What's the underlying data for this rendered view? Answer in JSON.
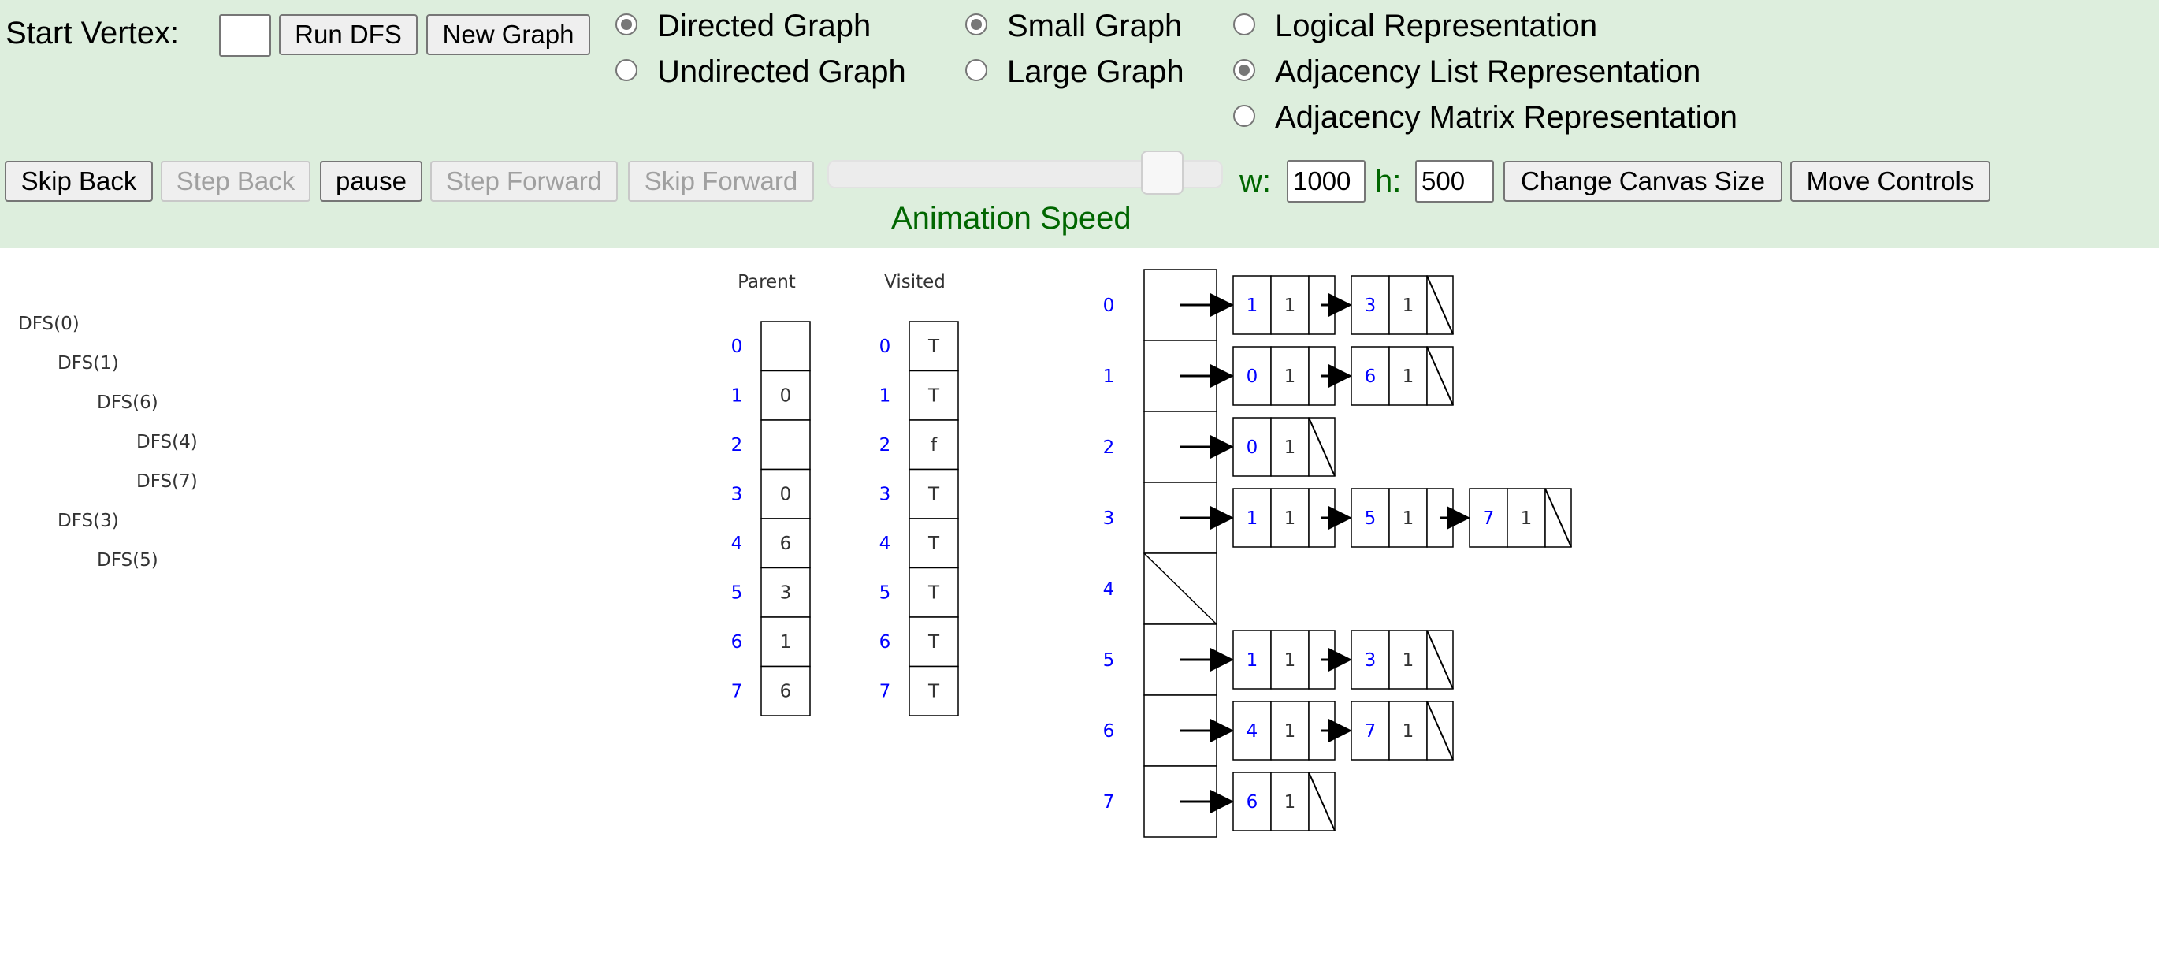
{
  "controls": {
    "start_vertex_label": "Start Vertex:",
    "start_vertex_value": "",
    "run_button": "Run DFS",
    "new_graph_button": "New Graph",
    "graph_type": {
      "directed": "Directed Graph",
      "undirected": "Undirected Graph",
      "selected": "directed"
    },
    "graph_size": {
      "small": "Small Graph",
      "large": "Large Graph",
      "selected": "small"
    },
    "representation": {
      "logical": "Logical Representation",
      "adjlist": "Adjacency List Representation",
      "adjmatrix": "Adjacency Matrix Representation",
      "selected": "adjlist"
    },
    "skip_back": "Skip Back",
    "step_back": "Step Back",
    "pause": "pause",
    "step_forward": "Step Forward",
    "skip_forward": "Skip Forward",
    "animation_speed": "Animation Speed",
    "width_label": "w:",
    "width_value": "1000",
    "height_label": "h:",
    "height_value": "500",
    "change_canvas_button": "Change Canvas Size",
    "move_controls_button": "Move Controls"
  },
  "colors": {
    "bar_bg": "#ddeedd",
    "green_text": "#006600",
    "index_blue": "#0000ff"
  },
  "animation": {
    "dfs_calls": [
      {
        "label": "DFS(0)",
        "depth": 0
      },
      {
        "label": "DFS(1)",
        "depth": 1
      },
      {
        "label": "DFS(6)",
        "depth": 2
      },
      {
        "label": "DFS(4)",
        "depth": 3
      },
      {
        "label": "DFS(7)",
        "depth": 3
      },
      {
        "label": "DFS(3)",
        "depth": 1
      },
      {
        "label": "DFS(5)",
        "depth": 2
      }
    ],
    "parent_title": "Parent",
    "visited_title": "Visited",
    "indices": [
      "0",
      "1",
      "2",
      "3",
      "4",
      "5",
      "6",
      "7"
    ],
    "parent": [
      "",
      "0",
      "",
      "0",
      "6",
      "3",
      "1",
      "6"
    ],
    "visited": [
      "T",
      "T",
      "f",
      "T",
      "T",
      "T",
      "T",
      "T"
    ],
    "adjacency": [
      [
        [
          "1",
          "1"
        ],
        [
          "3",
          "1"
        ]
      ],
      [
        [
          "0",
          "1"
        ],
        [
          "6",
          "1"
        ]
      ],
      [
        [
          "0",
          "1"
        ]
      ],
      [
        [
          "1",
          "1"
        ],
        [
          "5",
          "1"
        ],
        [
          "7",
          "1"
        ]
      ],
      [],
      [
        [
          "1",
          "1"
        ],
        [
          "3",
          "1"
        ]
      ],
      [
        [
          "4",
          "1"
        ],
        [
          "7",
          "1"
        ]
      ],
      [
        [
          "6",
          "1"
        ]
      ]
    ]
  }
}
